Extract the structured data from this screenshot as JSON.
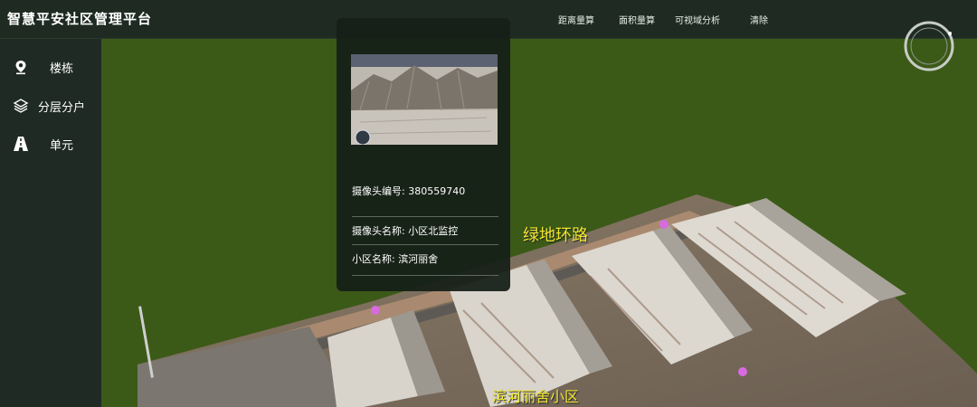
{
  "app": {
    "title": "智慧平安社区管理平台"
  },
  "toolbar": {
    "items": [
      {
        "label": "距离量算"
      },
      {
        "label": "面积量算"
      },
      {
        "label": "可视域分析"
      },
      {
        "label": "清除"
      }
    ]
  },
  "sidebar": {
    "items": [
      {
        "label": "楼栋",
        "icon": "location-pin-icon"
      },
      {
        "label": "分层分户",
        "icon": "layers-icon"
      },
      {
        "label": "单元",
        "icon": "road-icon"
      }
    ]
  },
  "popup": {
    "camera_id_label": "摄像头编号:",
    "camera_id_value": "380559740",
    "camera_name_label": "摄像头名称:",
    "camera_name_value": "小区北监控",
    "community_label": "小区名称:",
    "community_value": "滨河丽舍"
  },
  "map": {
    "road_label": "绿地环路",
    "community_label": "滨河丽舍小区"
  },
  "colors": {
    "topbar": "#1e2a22",
    "sidebar": "#1f2a24",
    "scene_ground": "#3b5a17",
    "map_label": "#f0e62a"
  }
}
